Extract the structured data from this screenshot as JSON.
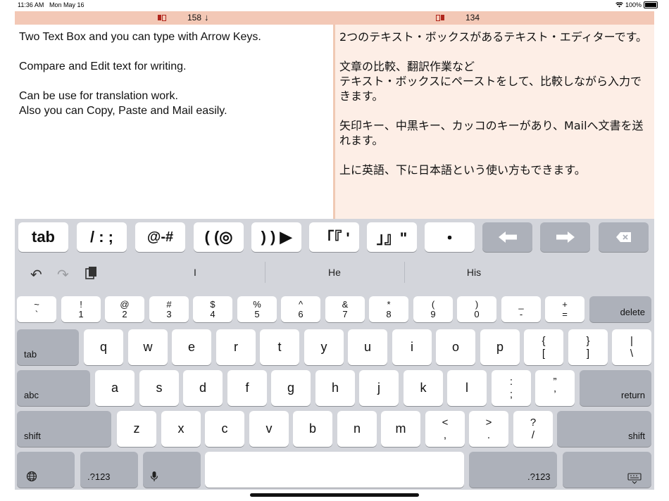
{
  "status_bar": {
    "time": "11:36 AM",
    "date": "Mon May 16",
    "battery": "100%"
  },
  "left_pane": {
    "count": "158",
    "arrow": "↓",
    "text": "Two Text Box and you can type with Arrow Keys.\n\nCompare and Edit text for writing.\n\nCan be use for translation work.\nAlso you can Copy, Paste and Mail easily."
  },
  "right_pane": {
    "count": "134",
    "text": "2つのテキスト・ボックスがあるテキスト・エディターです。\n\n文章の比較、翻訳作業など\nテキスト・ボックスにペーストをして、比較しながら入力できます。\n\n矢印キー、中黒キー、カッコのキーがあり、Mailへ文書を送れます。\n\n上に英語、下に日本語という使い方もできます。"
  },
  "accessory_bar": {
    "keys": [
      "tab",
      "/ : ;",
      "@-#",
      "( (◎",
      ") ) ▶",
      "「『 '",
      "」』\"",
      "・"
    ],
    "arrow_left_icon": "arrow-left-icon",
    "arrow_right_icon": "arrow-right-icon",
    "delete_icon": "delete-icon"
  },
  "suggestions": {
    "words": [
      "I",
      "He",
      "His"
    ],
    "undo_icon": "undo-icon",
    "redo_icon": "redo-icon",
    "paste_icon": "clipboard-icon"
  },
  "keyboard": {
    "number_row": [
      {
        "top": "~",
        "bottom": "`"
      },
      {
        "top": "!",
        "bottom": "1"
      },
      {
        "top": "@",
        "bottom": "2"
      },
      {
        "top": "#",
        "bottom": "3"
      },
      {
        "top": "$",
        "bottom": "4"
      },
      {
        "top": "%",
        "bottom": "5"
      },
      {
        "top": "^",
        "bottom": "6"
      },
      {
        "top": "&",
        "bottom": "7"
      },
      {
        "top": "*",
        "bottom": "8"
      },
      {
        "top": "(",
        "bottom": "9"
      },
      {
        "top": ")",
        "bottom": "0"
      },
      {
        "top": "_",
        "bottom": "-"
      },
      {
        "top": "+",
        "bottom": "="
      }
    ],
    "delete_label": "delete",
    "row1_letters": [
      "q",
      "w",
      "e",
      "r",
      "t",
      "y",
      "u",
      "i",
      "o",
      "p"
    ],
    "row1_extras": [
      {
        "top": "{",
        "bottom": "["
      },
      {
        "top": "}",
        "bottom": "]"
      },
      {
        "top": "|",
        "bottom": "\\"
      }
    ],
    "tab_label": "tab",
    "row2_letters": [
      "a",
      "s",
      "d",
      "f",
      "g",
      "h",
      "j",
      "k",
      "l"
    ],
    "row2_extras": [
      {
        "top": ":",
        "bottom": ";"
      },
      {
        "top": "”",
        "bottom": "’"
      }
    ],
    "abc_label": "abc",
    "return_label": "return",
    "row3_letters": [
      "z",
      "x",
      "c",
      "v",
      "b",
      "n",
      "m"
    ],
    "row3_extras": [
      {
        "top": "<",
        "bottom": ","
      },
      {
        "top": ">",
        "bottom": "."
      },
      {
        "top": "?",
        "bottom": "/"
      }
    ],
    "shift_label": "shift",
    "numbers_label": ".?123",
    "globe_icon": "globe-icon",
    "mic_icon": "microphone-icon",
    "hide_keyboard_icon": "keyboard-hide-icon"
  }
}
